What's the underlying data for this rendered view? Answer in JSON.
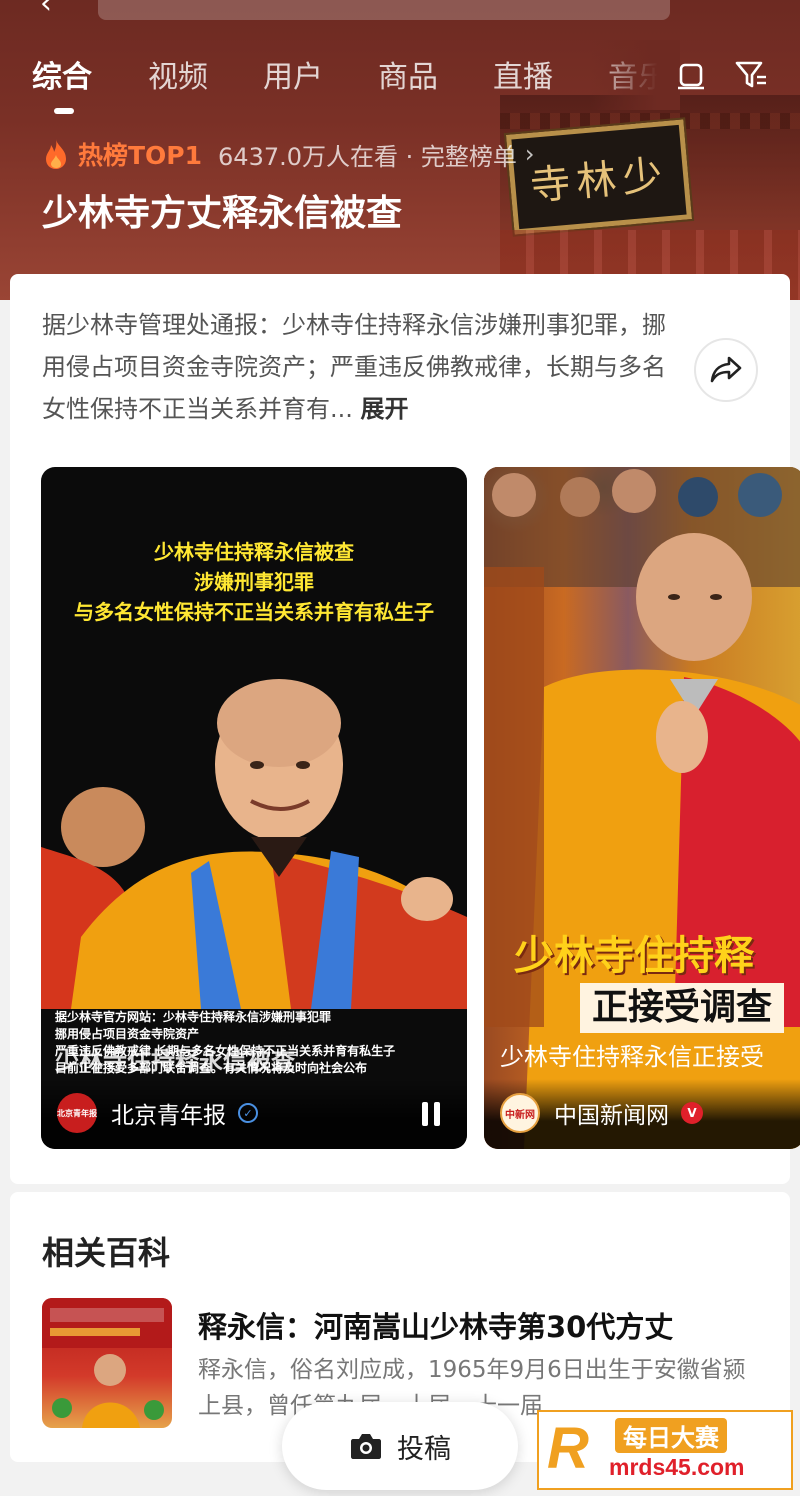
{
  "nav": {
    "tabs": [
      "综合",
      "视频",
      "用户",
      "商品",
      "直播",
      "音乐"
    ],
    "active_tab_index": 0
  },
  "temple_plaque_text": "寺林少",
  "hot": {
    "label": "热榜TOP1",
    "views": "6437.0万人在看 · 完整榜单",
    "chevron": "›",
    "title": "少林寺方丈释永信被查"
  },
  "summary": {
    "text": "据少林寺管理处通报：少林寺住持释永信涉嫌刑事犯罪，挪用侵占项目资金寺院资产；严重违反佛教戒律，长期与多名女性保持不正当关系并育有...",
    "expand_label": "展开"
  },
  "video1": {
    "caption_lines": [
      "少林寺住持释永信被查",
      "涉嫌刑事犯罪",
      "与多名女性保持不正当关系并育有私生子"
    ],
    "sub_lines": [
      "据少林寺官方网站：少林寺住持释永信涉嫌刑事犯罪",
      "挪用侵占项目资金寺院资产",
      "严重违反佛教戒律 长期与多名女性保持不正当关系并育有私生子",
      "目前正在接受多部门联合调查。有关情况将及时向社会公布"
    ],
    "overlay_title": "少林寺住持释永信被查",
    "source": "北京青年报",
    "logo_text": "北京青年报"
  },
  "video2": {
    "big_text": "少林寺住持释",
    "sub_box": "正接受调查",
    "title": "少林寺住持释永信正接受",
    "source": "中国新闻网",
    "logo_text": "中新网",
    "verified_label": "V"
  },
  "baike": {
    "heading": "相关百科",
    "title": "释永信：河南嵩山少林寺第30代方丈",
    "desc": "释永信，俗名刘应成，1965年9月6日出生于安徽省颍上县，曾任第九届、十届、十一届…"
  },
  "post_button": "投稿",
  "watermark": {
    "logo": "R",
    "top": "每日大赛",
    "bottom": "mrds45.com"
  },
  "colors": {
    "header_bg": "#7a3026",
    "hot_accent": "#ff7a3c",
    "caption_yellow": "#ffe733",
    "verified_red": "#e0202a"
  }
}
